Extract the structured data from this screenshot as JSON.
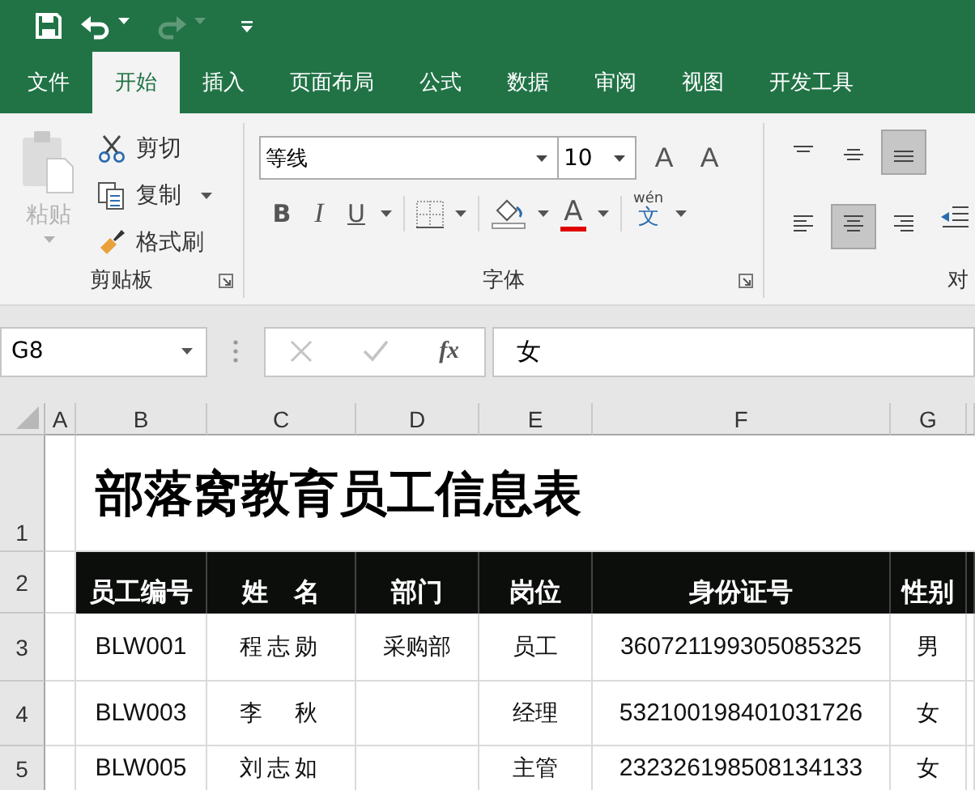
{
  "tabs": [
    {
      "label": "文件",
      "selected": false
    },
    {
      "label": "开始",
      "selected": true
    },
    {
      "label": "插入",
      "selected": false
    },
    {
      "label": "页面布局",
      "selected": false
    },
    {
      "label": "公式",
      "selected": false
    },
    {
      "label": "数据",
      "selected": false
    },
    {
      "label": "审阅",
      "selected": false
    },
    {
      "label": "视图",
      "selected": false
    },
    {
      "label": "开发工具",
      "selected": false
    }
  ],
  "clipboard": {
    "label": "剪贴板",
    "paste": {
      "label": "粘贴",
      "disabled": true
    },
    "actions": [
      {
        "kind": "cut",
        "label": "剪切",
        "dropdown": false
      },
      {
        "kind": "copy",
        "label": "复制",
        "dropdown": true
      },
      {
        "kind": "format_painter",
        "label": "格式刷",
        "dropdown": false
      }
    ]
  },
  "font": {
    "label": "字体",
    "name": "等线",
    "size": "10",
    "grow": "A",
    "shrink": "A",
    "bold": "B",
    "italic": "I",
    "underline": "U",
    "font_color": "A",
    "pinyin": "wén",
    "character": "文"
  },
  "alignment": {
    "label": "对",
    "buttons": [
      {
        "kind": "top",
        "selected": false
      },
      {
        "kind": "middle",
        "selected": false
      },
      {
        "kind": "bottom",
        "selected": true
      },
      {
        "kind": "left",
        "selected": false
      },
      {
        "kind": "center",
        "selected": true
      },
      {
        "kind": "right",
        "selected": false
      }
    ]
  },
  "formula_bar": {
    "name_box": "G8",
    "function_label": "fx",
    "value": "女"
  },
  "sheet": {
    "columns": [
      "A",
      "B",
      "C",
      "D",
      "E",
      "F",
      "G"
    ],
    "row_numbers": [
      "1",
      "2",
      "3",
      "4",
      "5"
    ],
    "title": "部落窝教育员工信息表",
    "header": [
      "员工编号",
      "姓　名",
      "部门",
      "岗位",
      "身份证号",
      "性别"
    ],
    "rows": [
      {
        "id": "BLW001",
        "name": "程志勋",
        "department": "采购部",
        "position": "员工",
        "id_number": "360721199305085325",
        "gender": "男"
      },
      {
        "id": "BLW003",
        "name": "李　秋",
        "position": "经理",
        "id_number": "532100198401031726",
        "gender": "女"
      },
      {
        "id": "BLW005",
        "name": "刘志如",
        "position": "主管",
        "id_number": "232326198508134133",
        "gender": "女"
      }
    ]
  }
}
